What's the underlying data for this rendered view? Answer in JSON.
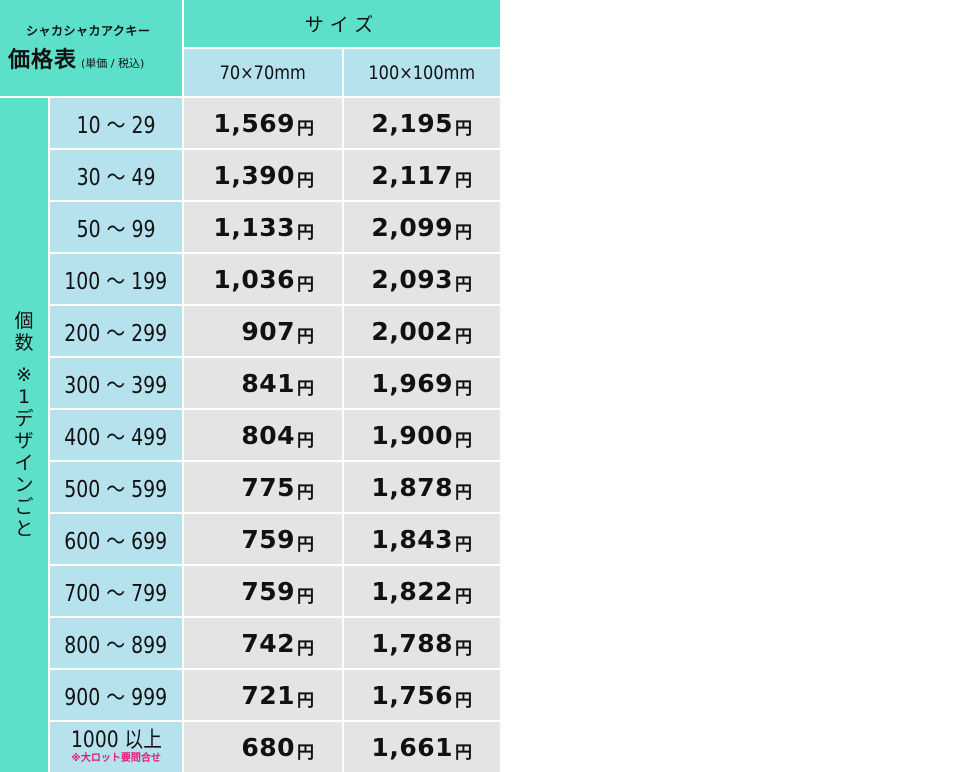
{
  "header": {
    "product": "シャカシャカアクキー",
    "title": "価格表",
    "note": "(単価 / 税込)",
    "size_label": "サイズ",
    "size_a": "70×70mm",
    "size_b": "100×100mm"
  },
  "side_label": [
    "個",
    "数",
    "※",
    "1",
    "デ",
    "ザ",
    "イ",
    "ン",
    "ご",
    "と"
  ],
  "currency": "円",
  "rows": [
    {
      "range": "10 ～ 29",
      "a": "1,569",
      "b": "2,195"
    },
    {
      "range": "30 ～ 49",
      "a": "1,390",
      "b": "2,117"
    },
    {
      "range": "50 ～ 99",
      "a": "1,133",
      "b": "2,099"
    },
    {
      "range": "100 ～ 199",
      "a": "1,036",
      "b": "2,093"
    },
    {
      "range": "200 ～ 299",
      "a": "907",
      "b": "2,002"
    },
    {
      "range": "300 ～ 399",
      "a": "841",
      "b": "1,969"
    },
    {
      "range": "400 ～ 499",
      "a": "804",
      "b": "1,900"
    },
    {
      "range": "500 ～ 599",
      "a": "775",
      "b": "1,878"
    },
    {
      "range": "600 ～ 699",
      "a": "759",
      "b": "1,843"
    },
    {
      "range": "700 ～ 799",
      "a": "759",
      "b": "1,822"
    },
    {
      "range": "800 ～ 899",
      "a": "742",
      "b": "1,788"
    },
    {
      "range": "900 ～ 999",
      "a": "721",
      "b": "1,756"
    }
  ],
  "last_row": {
    "range": "1000 以上",
    "note": "※大ロット要問合せ",
    "a": "680",
    "b": "1,661"
  },
  "colors": {
    "teal": "#5de0c9",
    "light_blue": "#b6e2ee",
    "gray": "#e4e4e4",
    "note_pink": "#e5197a"
  }
}
